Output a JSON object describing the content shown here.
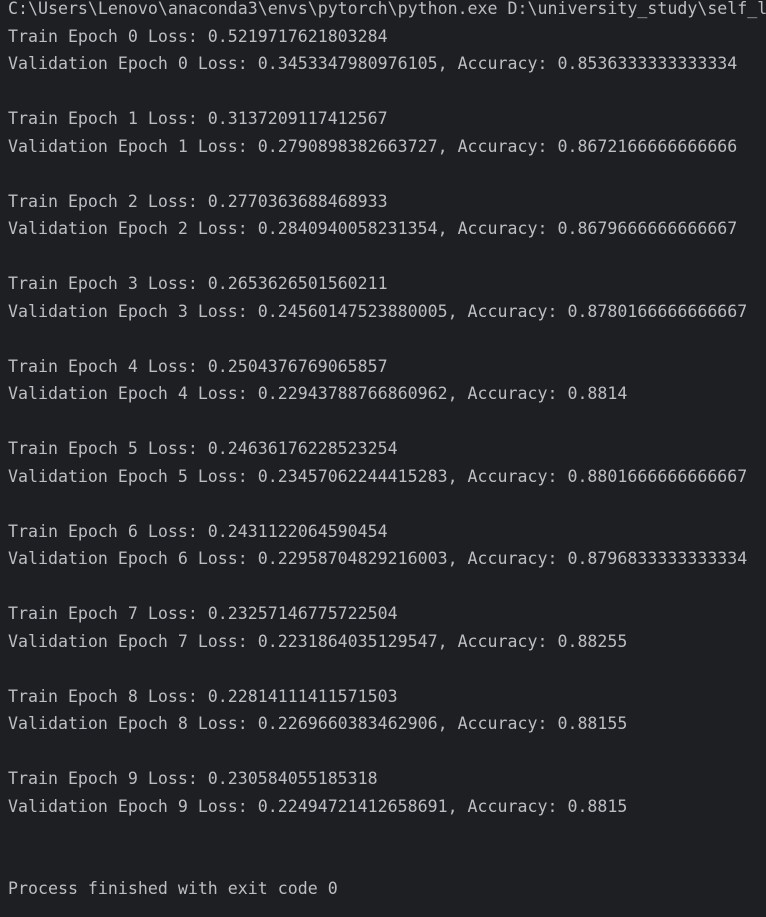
{
  "console": {
    "command": "C:\\Users\\Lenovo\\anaconda3\\envs\\pytorch\\python.exe D:\\university_study\\self_l",
    "epochs": [
      {
        "train": "Train Epoch 0 Loss: 0.5219717621803284",
        "validation": "Validation Epoch 0 Loss: 0.3453347980976105, Accuracy: 0.8536333333333334"
      },
      {
        "train": "Train Epoch 1 Loss: 0.3137209117412567",
        "validation": "Validation Epoch 1 Loss: 0.2790898382663727, Accuracy: 0.8672166666666666"
      },
      {
        "train": "Train Epoch 2 Loss: 0.2770363688468933",
        "validation": "Validation Epoch 2 Loss: 0.2840940058231354, Accuracy: 0.8679666666666667"
      },
      {
        "train": "Train Epoch 3 Loss: 0.2653626501560211",
        "validation": "Validation Epoch 3 Loss: 0.24560147523880005, Accuracy: 0.8780166666666667"
      },
      {
        "train": "Train Epoch 4 Loss: 0.2504376769065857",
        "validation": "Validation Epoch 4 Loss: 0.22943788766860962, Accuracy: 0.8814"
      },
      {
        "train": "Train Epoch 5 Loss: 0.24636176228523254",
        "validation": "Validation Epoch 5 Loss: 0.23457062244415283, Accuracy: 0.8801666666666667"
      },
      {
        "train": "Train Epoch 6 Loss: 0.2431122064590454",
        "validation": "Validation Epoch 6 Loss: 0.22958704829216003, Accuracy: 0.8796833333333334"
      },
      {
        "train": "Train Epoch 7 Loss: 0.23257146775722504",
        "validation": "Validation Epoch 7 Loss: 0.2231864035129547, Accuracy: 0.88255"
      },
      {
        "train": "Train Epoch 8 Loss: 0.22814111411571503",
        "validation": "Validation Epoch 8 Loss: 0.2269660383462906, Accuracy: 0.88155"
      },
      {
        "train": "Train Epoch 9 Loss: 0.230584055185318",
        "validation": "Validation Epoch 9 Loss: 0.22494721412658691, Accuracy: 0.8815"
      }
    ],
    "exit_message": "Process finished with exit code 0"
  },
  "colors": {
    "background": "#1e1f22",
    "text": "#bcbec4"
  }
}
